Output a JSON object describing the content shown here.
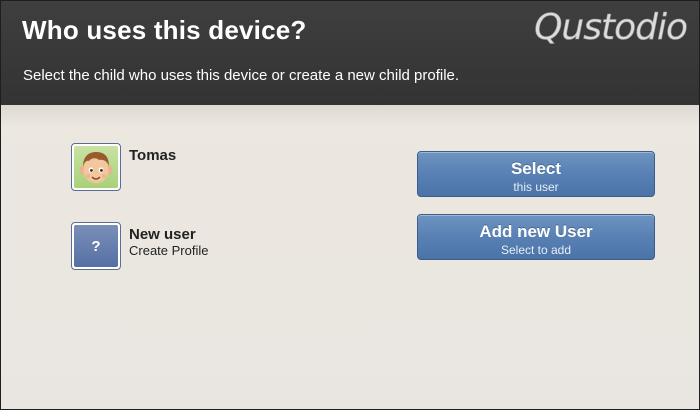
{
  "header": {
    "title": "Who uses this device?",
    "subtitle": "Select the child who uses this device or create a new child profile.",
    "logo": "Qustodio"
  },
  "users": [
    {
      "name": "Tomas",
      "avatar_icon": "child-face-icon",
      "button_label": "Select",
      "button_sub": "this user"
    },
    {
      "name": "New user",
      "sub": "Create Profile",
      "avatar_glyph": "?",
      "avatar_icon": "question-mark-icon",
      "button_label": "Add new User",
      "button_sub": "Select to add"
    }
  ],
  "colors": {
    "header_bg": "#3b3b3b",
    "button_blue": "#5a82b5",
    "body_bg": "#ebe7e0"
  }
}
